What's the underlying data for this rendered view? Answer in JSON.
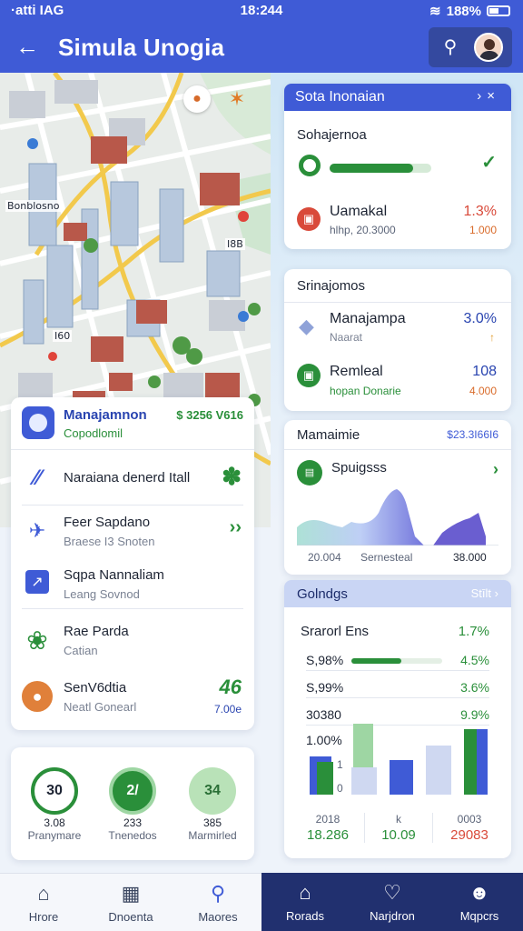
{
  "status_bar": {
    "left": "·atti IAG",
    "time": "18:244",
    "battery": "188%"
  },
  "appbar": {
    "title": "Simula Unogia"
  },
  "map": {
    "labels": [
      "Bonblosno",
      "I8B",
      "I60"
    ]
  },
  "list_card": {
    "header": {
      "title": "Manajamnon",
      "subtitle": "Copodlomil",
      "amount": "$ 3256 V616"
    },
    "rows": [
      {
        "title": "Naraiana denerd Itall",
        "subtitle": "",
        "icon": "stripes-icon",
        "trail_icon": "leaf-icon"
      },
      {
        "title": "Feer Sapdano",
        "subtitle": "Braese I3 Snoten",
        "icon": "truck-icon",
        "trail": "››"
      },
      {
        "title": "Sqpa Nannaliam",
        "subtitle": "Leang Sovnod",
        "icon": "chart-icon",
        "trail": ""
      },
      {
        "title": "Rae Parda",
        "subtitle": "Catian",
        "icon": "globe-icon",
        "trail": ""
      },
      {
        "title": "SenV6dtia",
        "subtitle": "Neatl Gonearl",
        "icon": "person-icon",
        "trail": "46",
        "trail_sub": "7.00e"
      }
    ]
  },
  "gauges": [
    {
      "value": "30",
      "amount": "3.08",
      "label": "Pranymare"
    },
    {
      "value": "2/",
      "amount": "233",
      "label": "Tnenedos"
    },
    {
      "value": "34",
      "amount": "385",
      "label": "Marmirled"
    }
  ],
  "panel1": {
    "title": "Sota Inonaian",
    "subtitle": "Sohajernoa",
    "row": {
      "name": "Uamakal",
      "sub": "hlhp, 20.3000",
      "pct": "1.3%",
      "amount": "1.000"
    },
    "progress": 0.82
  },
  "panel2": {
    "title": "Srinajomos",
    "rows": [
      {
        "name": "Manajampa",
        "sub": "Naarat",
        "value": "3.0%",
        "sub_value": "↑"
      },
      {
        "name": "Remleal",
        "sub": "hopan Donarie",
        "value": "108",
        "sub_value": "4.000"
      }
    ]
  },
  "panel3": {
    "title": "Mamaimie",
    "link": "$23.3I66I6",
    "series_name": "Spuigsss",
    "axis": [
      "20.004",
      "Sernesteal",
      "38.000"
    ]
  },
  "panel4": {
    "header": "Golndgs",
    "header_more": "Stīlt",
    "caption": "Srarorl Ens",
    "caption_value": "1.7%",
    "lines": [
      {
        "k": "S,98%",
        "v": "4.5%",
        "bar": 0.55
      },
      {
        "k": "S,99%",
        "v": "3.6%"
      },
      {
        "k": "30380",
        "v": "9.9%"
      },
      {
        "k": "1.00%",
        "v": ""
      }
    ],
    "bars_axis": [
      "1",
      "0"
    ],
    "footer": [
      {
        "label": "2018",
        "value": "18.286"
      },
      {
        "label": "k",
        "value": "10.09"
      },
      {
        "label": "0003",
        "value": "29083"
      }
    ]
  },
  "nav_left": [
    {
      "label": "Hrore",
      "icon": "home-icon"
    },
    {
      "label": "Dnoenta",
      "icon": "grid-icon"
    },
    {
      "label": "Maores",
      "icon": "search-icon"
    }
  ],
  "nav_right": [
    {
      "label": "Rorads",
      "icon": "home-icon"
    },
    {
      "label": "Narjdron",
      "icon": "heart-icon"
    },
    {
      "label": "Mqpcrs",
      "icon": "user-icon"
    }
  ]
}
